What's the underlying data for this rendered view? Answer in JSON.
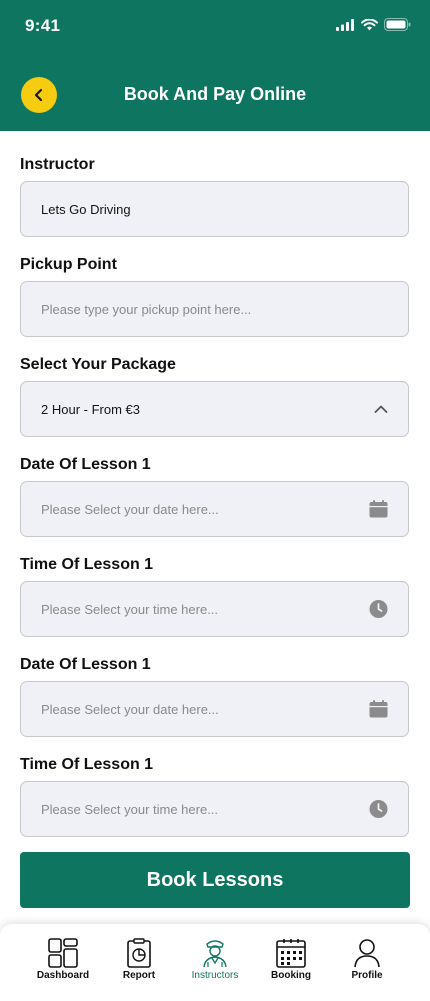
{
  "status_bar": {
    "time": "9:41"
  },
  "header": {
    "title": "Book And Pay Online"
  },
  "form": {
    "instructor": {
      "label": "Instructor",
      "value": "Lets Go Driving"
    },
    "pickup": {
      "label": "Pickup Point",
      "placeholder": "Please type your pickup point here..."
    },
    "package": {
      "label": "Select Your Package",
      "value": "2 Hour - From €3"
    },
    "date1": {
      "label": "Date Of Lesson 1",
      "placeholder": "Please Select your date here..."
    },
    "time1": {
      "label": "Time Of Lesson 1",
      "placeholder": "Please Select your time here..."
    },
    "date2": {
      "label": "Date Of Lesson 1",
      "placeholder": "Please Select your date here..."
    },
    "time2": {
      "label": "Time Of Lesson 1",
      "placeholder": "Please Select your time here..."
    }
  },
  "submit": {
    "label": "Book Lessons"
  },
  "tabbar": {
    "items": [
      {
        "label": "Dashboard",
        "icon": "dashboard-icon"
      },
      {
        "label": "Report",
        "icon": "report-icon"
      },
      {
        "label": "Instructors",
        "icon": "instructor-icon",
        "active": true
      },
      {
        "label": "Booking",
        "icon": "calendar-icon"
      },
      {
        "label": "Profile",
        "icon": "profile-icon"
      }
    ]
  },
  "colors": {
    "primary": "#0e7660",
    "accent": "#f5cc0f",
    "field_bg": "#f0f1f6"
  }
}
